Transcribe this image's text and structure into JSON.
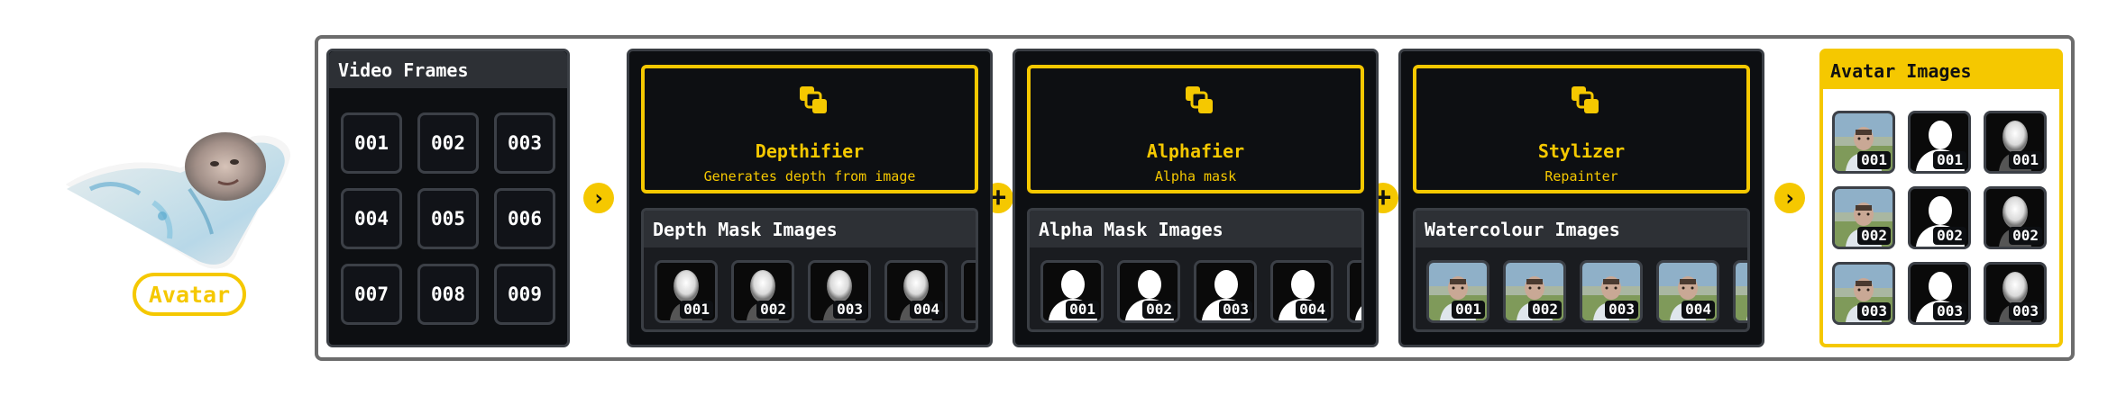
{
  "avatar": {
    "label": "Avatar"
  },
  "video_frames": {
    "title": "Video Frames",
    "frames": [
      "001",
      "002",
      "003",
      "004",
      "005",
      "006",
      "007",
      "008",
      "009"
    ]
  },
  "processors": [
    {
      "title": "Depthifier",
      "subtitle": "Generates depth from image",
      "output_title": "Depth Mask Images",
      "kind": "depth",
      "thumbs": [
        "001",
        "002",
        "003",
        "004"
      ]
    },
    {
      "title": "Alphafier",
      "subtitle": "Alpha mask",
      "output_title": "Alpha Mask Images",
      "kind": "alpha",
      "thumbs": [
        "001",
        "002",
        "003",
        "004"
      ]
    },
    {
      "title": "Stylizer",
      "subtitle": "Repainter",
      "output_title": "Watercolour Images",
      "kind": "water",
      "thumbs": [
        "001",
        "002",
        "003",
        "004"
      ]
    }
  ],
  "connectors": {
    "arrow": "›",
    "plus": "+"
  },
  "avatar_images": {
    "title": "Avatar Images",
    "rows": [
      [
        {
          "kind": "water",
          "label": "001"
        },
        {
          "kind": "alpha",
          "label": "001"
        },
        {
          "kind": "depth",
          "label": "001"
        }
      ],
      [
        {
          "kind": "water",
          "label": "002"
        },
        {
          "kind": "alpha",
          "label": "002"
        },
        {
          "kind": "depth",
          "label": "002"
        }
      ],
      [
        {
          "kind": "water",
          "label": "003"
        },
        {
          "kind": "alpha",
          "label": "003"
        },
        {
          "kind": "depth",
          "label": "003"
        }
      ]
    ]
  },
  "colors": {
    "accent": "#f5c800",
    "panel": "#0d0f12",
    "header": "#2d3035",
    "border": "#6c6c6c"
  }
}
